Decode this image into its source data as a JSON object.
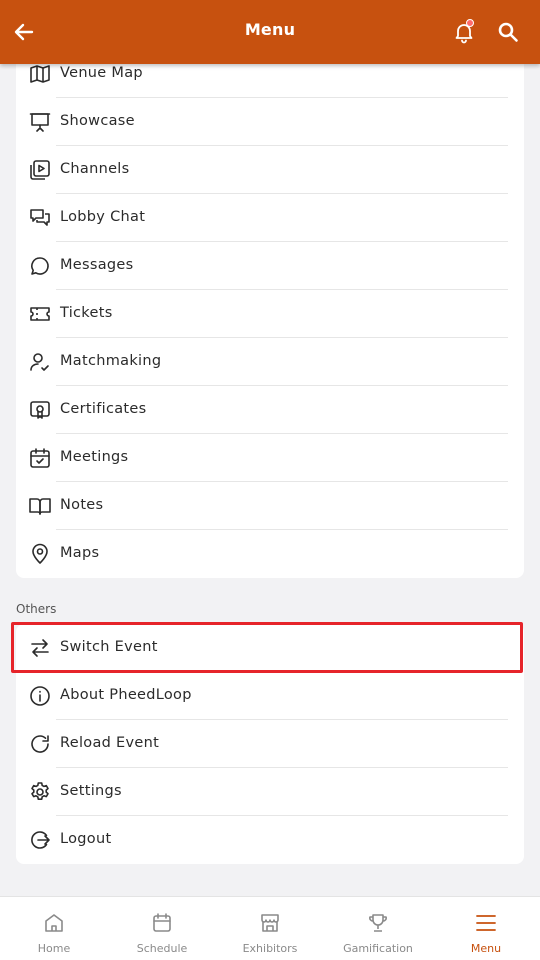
{
  "header": {
    "title": "Menu"
  },
  "menu_items": [
    {
      "label": "Venue Map",
      "icon": "map-icon"
    },
    {
      "label": "Showcase",
      "icon": "presentation-icon"
    },
    {
      "label": "Channels",
      "icon": "video-playlist-icon"
    },
    {
      "label": "Lobby Chat",
      "icon": "chat-bubbles-icon"
    },
    {
      "label": "Messages",
      "icon": "message-circle-icon"
    },
    {
      "label": "Tickets",
      "icon": "ticket-icon"
    },
    {
      "label": "Matchmaking",
      "icon": "user-check-icon"
    },
    {
      "label": "Certificates",
      "icon": "certificate-icon"
    },
    {
      "label": "Meetings",
      "icon": "calendar-check-icon"
    },
    {
      "label": "Notes",
      "icon": "book-open-icon"
    },
    {
      "label": "Maps",
      "icon": "map-pin-icon"
    }
  ],
  "others": {
    "title": "Others",
    "items": [
      {
        "label": "Switch Event",
        "icon": "switch-arrows-icon"
      },
      {
        "label": "About PheedLoop",
        "icon": "info-icon"
      },
      {
        "label": "Reload Event",
        "icon": "reload-icon"
      },
      {
        "label": "Settings",
        "icon": "gear-icon"
      },
      {
        "label": "Logout",
        "icon": "logout-icon"
      }
    ]
  },
  "bottom_nav": [
    {
      "label": "Home",
      "icon": "home-icon",
      "active": false
    },
    {
      "label": "Schedule",
      "icon": "calendar-icon",
      "active": false
    },
    {
      "label": "Exhibitors",
      "icon": "booth-icon",
      "active": false
    },
    {
      "label": "Gamification",
      "icon": "trophy-icon",
      "active": false
    },
    {
      "label": "Menu",
      "icon": "hamburger-menu-icon",
      "active": true
    }
  ],
  "colors": {
    "brand": "#c7510f",
    "highlight_border": "#e6242a",
    "notification_dot": "#ff6b6b"
  }
}
